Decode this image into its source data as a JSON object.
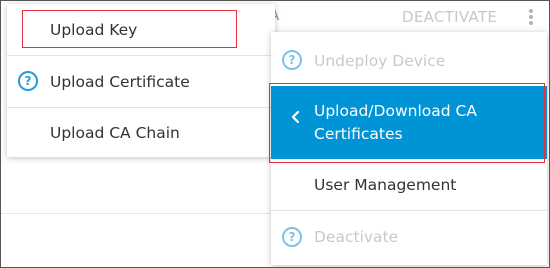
{
  "background": {
    "header_fragment": "A",
    "deactivate_label": "DEACTIVATE"
  },
  "left_menu": {
    "items": [
      {
        "label": "Upload Key",
        "icon": null
      },
      {
        "label": "Upload Certificate",
        "icon": "help-icon"
      },
      {
        "label": "Upload CA Chain",
        "icon": null
      }
    ]
  },
  "right_menu": {
    "items": [
      {
        "label": "Undeploy Device",
        "icon": "help-icon",
        "state": "disabled"
      },
      {
        "label": "Upload/Download CA Certificates",
        "line1": "Upload/Download CA",
        "line2": "Certificates",
        "icon": "chevron-left-icon",
        "state": "selected"
      },
      {
        "label": "User Management",
        "icon": null,
        "state": "enabled"
      },
      {
        "label": "Deactivate",
        "icon": "help-icon",
        "state": "disabled"
      }
    ]
  },
  "icons": {
    "help_glyph": "?"
  },
  "colors": {
    "accent": "#0094d6",
    "help_icon": "#2b9bd8",
    "disabled_text": "#c9c9c9",
    "highlight_border": "#e0333b"
  }
}
